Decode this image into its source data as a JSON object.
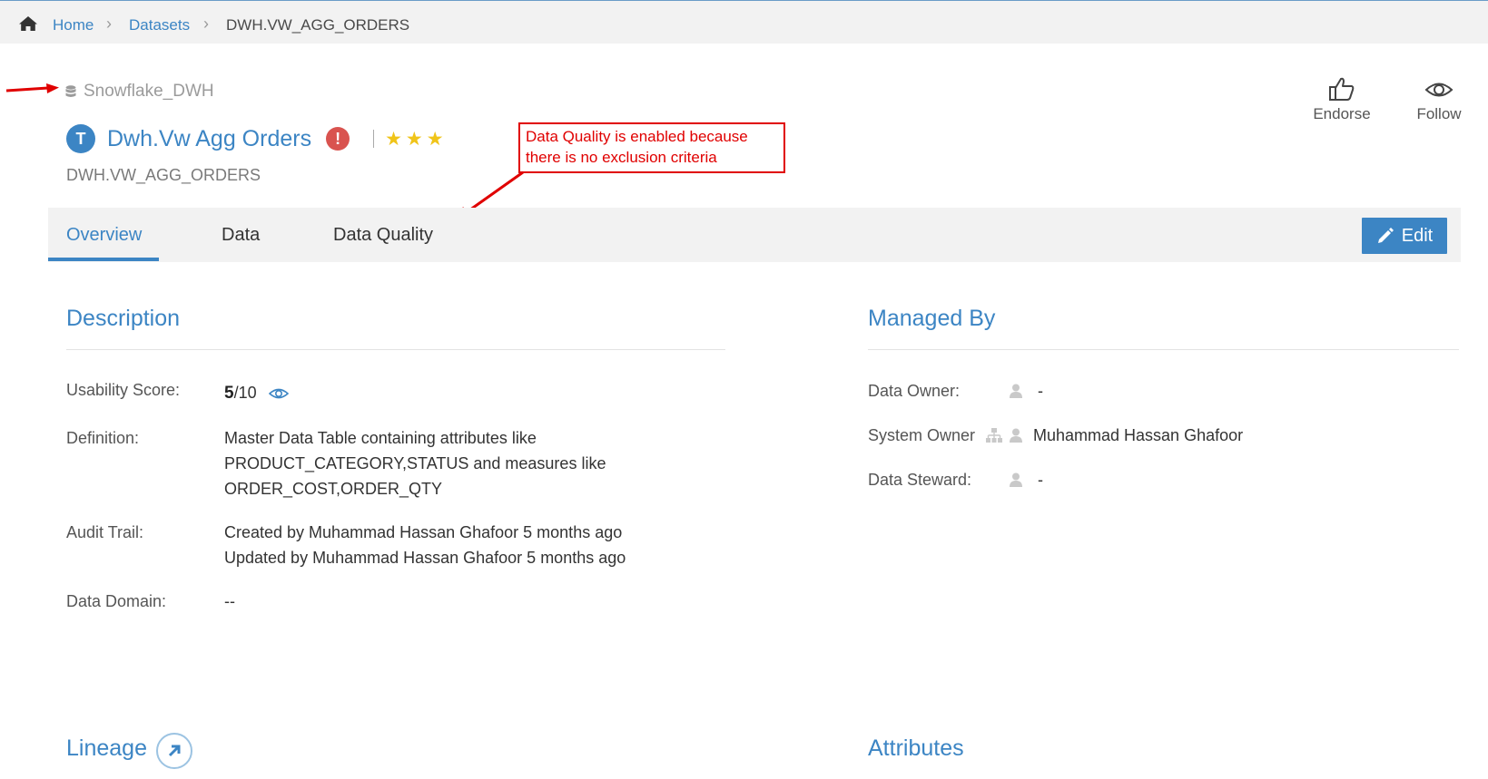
{
  "breadcrumb": {
    "home_icon": "home-icon",
    "items": [
      "Home",
      "Datasets",
      "DWH.VW_AGG_ORDERS"
    ]
  },
  "source": {
    "icon": "database-icon",
    "name": "Snowflake_DWH"
  },
  "dataset": {
    "type_badge": "T",
    "title": "Dwh.Vw Agg Orders",
    "alert_icon": "!",
    "rating_stars": 3,
    "technical_name": "DWH.VW_AGG_ORDERS"
  },
  "annotation": {
    "line1": "Data Quality is enabled because",
    "line2": "there is no exclusion criteria",
    "color": "#e00000"
  },
  "actions": {
    "endorse_label": "Endorse",
    "follow_label": "Follow"
  },
  "tabs": [
    {
      "label": "Overview",
      "active": true
    },
    {
      "label": "Data",
      "active": false
    },
    {
      "label": "Data Quality",
      "active": false
    }
  ],
  "edit_label": "Edit",
  "description": {
    "title": "Description",
    "usability_label": "Usability Score:",
    "usability_score": "5",
    "usability_max": "/10",
    "definition_label": "Definition:",
    "definition_lines": [
      "Master Data Table containing attributes like",
      "PRODUCT_CATEGORY,STATUS and measures like",
      "ORDER_COST,ORDER_QTY"
    ],
    "audit_label": "Audit Trail:",
    "audit_lines": [
      "Created by Muhammad Hassan Ghafoor 5 months ago",
      "Updated by Muhammad Hassan Ghafoor 5 months ago"
    ],
    "domain_label": "Data Domain:",
    "domain_value": "--"
  },
  "managed_by": {
    "title": "Managed By",
    "data_owner_label": "Data Owner:",
    "data_owner_value": "-",
    "system_owner_label": "System Owner",
    "system_owner_value": "Muhammad Hassan Ghafoor",
    "data_steward_label": "Data Steward:",
    "data_steward_value": "-"
  },
  "lineage": {
    "title": "Lineage"
  },
  "attributes": {
    "title": "Attributes"
  },
  "colors": {
    "accent": "#3c85c4",
    "alert": "#d9534f",
    "star": "#f0c419",
    "tabbar_bg": "#f2f2f2"
  }
}
